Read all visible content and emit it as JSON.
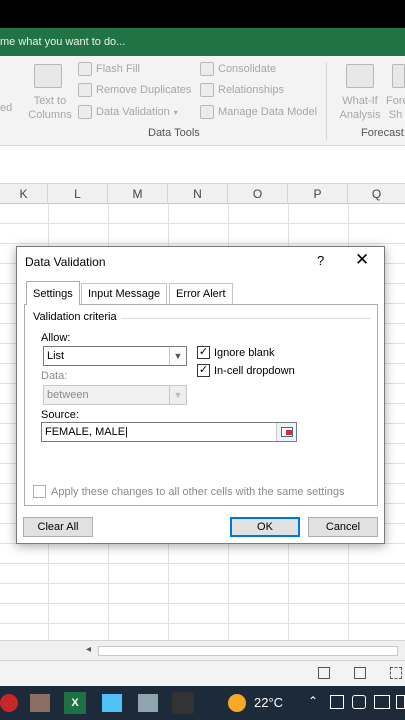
{
  "ribbon": {
    "tell_me": "me what you want to do...",
    "left_partial": "ed",
    "text_to_columns": [
      "Text to",
      "Columns"
    ],
    "flash_fill": "Flash Fill",
    "remove_duplicates": "Remove Duplicates",
    "data_validation": "Data Validation",
    "consolidate": "Consolidate",
    "relationships": "Relationships",
    "manage_data_model": "Manage Data Model",
    "what_if": [
      "What-If",
      "Analysis"
    ],
    "forecast_sheet": [
      "Fore",
      "Sh"
    ],
    "group_data_tools": "Data Tools",
    "group_forecast": "Forecast"
  },
  "columns": [
    "K",
    "L",
    "M",
    "N",
    "O",
    "P",
    "Q"
  ],
  "dialog": {
    "title": "Data Validation",
    "help": "?",
    "close": "✕",
    "tabs": [
      "Settings",
      "Input Message",
      "Error Alert"
    ],
    "section_title": "Validation criteria",
    "allow_label": "Allow:",
    "allow_value": "List",
    "data_label": "Data:",
    "data_value": "between",
    "ignore_blank": "Ignore blank",
    "in_cell_dropdown": "In-cell dropdown",
    "source_label": "Source:",
    "source_value": "FEMALE, MALE",
    "apply_all": "Apply these changes to all other cells with the same settings",
    "clear_all": "Clear All",
    "ok": "OK",
    "cancel": "Cancel"
  },
  "taskbar": {
    "temperature": "22°C"
  }
}
